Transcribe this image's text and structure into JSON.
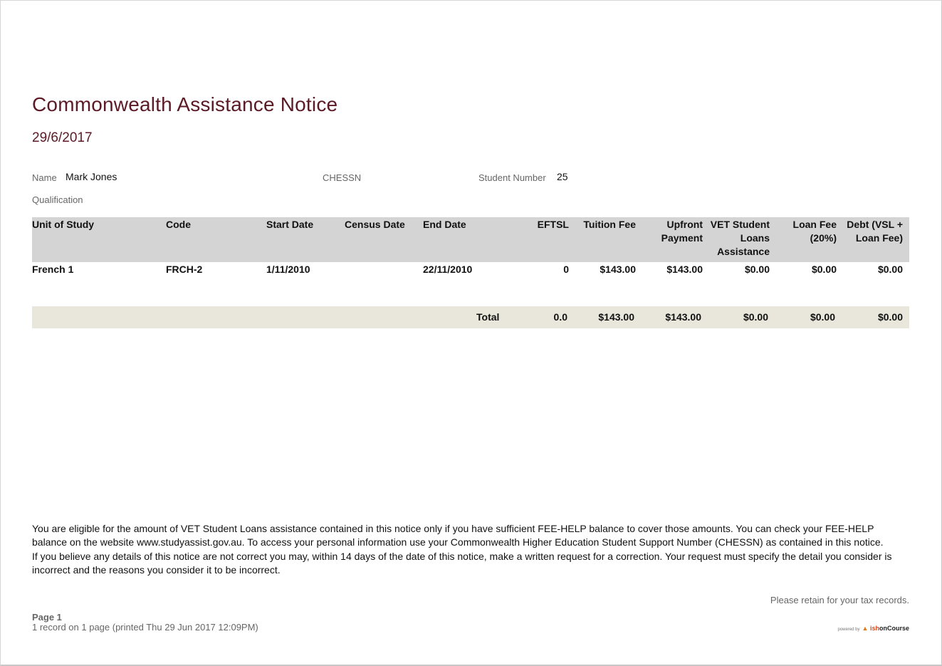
{
  "document": {
    "title": "Commonwealth Assistance Notice",
    "date": "29/6/2017"
  },
  "student": {
    "name_label": "Name",
    "name_value": "Mark Jones",
    "chessn_label": "CHESSN",
    "chessn_value": "",
    "student_number_label": "Student Number",
    "student_number_value": "25",
    "qualification_label": "Qualification"
  },
  "table": {
    "headers": [
      "Unit of Study",
      "Code",
      "Start Date",
      "Census Date",
      "End Date",
      "EFTSL",
      "Tuition Fee",
      "Upfront Payment",
      "VET Student Loans Assistance",
      "Loan Fee (20%)",
      "Debt (VSL + Loan Fee)"
    ],
    "rows": [
      [
        "French 1",
        "FRCH-2",
        "1/11/2010",
        "",
        "22/11/2010",
        "0",
        "$143.00",
        "$143.00",
        "$0.00",
        "$0.00",
        "$0.00"
      ]
    ]
  },
  "totals": {
    "label": "Total",
    "eftsl": "0.0",
    "tuition_fee": "$143.00",
    "upfront_payment": "$143.00",
    "vsl_assistance": "$0.00",
    "loan_fee": "$0.00",
    "debt": "$0.00"
  },
  "disclaimer": {
    "para1": "You are eligible for the amount of VET Student Loans assistance contained in this notice only if you have sufficient FEE-HELP balance to cover those amounts. You can check your FEE-HELP balance on the website www.studyassist.gov.au. To access your personal information use your Commonwealth Higher Education Student Support Number (CHESSN) as contained in this notice.",
    "para2": "If you believe any details of this notice are not correct you may, within 14 days of the date of this notice, make a written request for a correction. Your request must specify the detail you consider is incorrect and the reasons you consider it to be incorrect."
  },
  "footer": {
    "retain_note": "Please retain for your tax records.",
    "page_label": "Page 1",
    "printed_info": "1 record on 1 page (printed Thu 29 Jun 2017 12:09PM)",
    "powered_by": "powered by",
    "brand_ish": "ish",
    "brand_oncourse": "onCourse"
  },
  "colors": {
    "title": "#5b1a26",
    "header_bg": "#d4d4d4",
    "total_bg": "#e9e6db"
  }
}
